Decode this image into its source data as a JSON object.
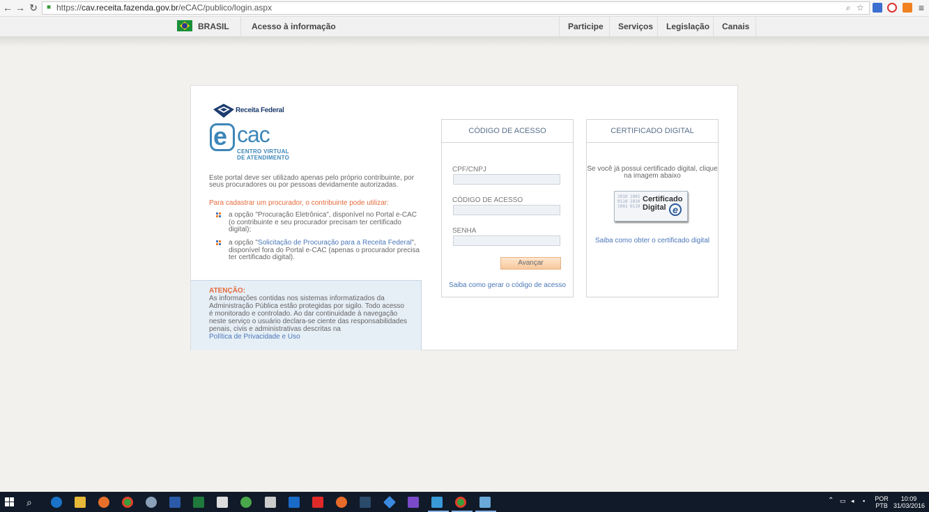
{
  "browser": {
    "url_scheme": "https://",
    "url_host": "cav.receita.fazenda.gov.br",
    "url_path": "/eCAC/publico/login.aspx"
  },
  "govbar": {
    "country": "BRASIL",
    "access": "Acesso à informação",
    "links": [
      "Participe",
      "Serviços",
      "Legislação",
      "Canais"
    ]
  },
  "brand": {
    "agency": "Receita Federal",
    "logo_name": "cac",
    "logo_sub_1": "CENTRO VIRTUAL",
    "logo_sub_2": "DE ATENDIMENTO"
  },
  "info": {
    "intro": "Este portal deve ser utilizado apenas pelo próprio contribuinte, por seus procuradores ou por pessoas devidamente autorizadas.",
    "cad_title": "Para cadastrar um procurador, o contribuinte pode utilizar:",
    "bullet1": "a opção \"Procuração Eletrônica\", disponível no Portal e-CAC (o contribuinte e seu procurador precisam ter certificado digital);",
    "bullet2_pre": "a opção \"",
    "bullet2_link": "Solicitação de Procuração para a Receita Federal",
    "bullet2_post": "\", disponível fora do Portal e-CAC (apenas o procurador precisa ter certificado digital)."
  },
  "attention": {
    "title": "ATENÇÃO:",
    "body": "As informações contidas nos sistemas informatizados da Administração Pública estão protegidas por sigilo. Todo acesso é monitorado e controlado. Ao dar continuidade à navegação neste serviço o usuário declara-se ciente das responsabilidades penais, civis e administrativas descritas na",
    "link": "Política de Privacidade e Uso"
  },
  "access_code": {
    "title": "CÓDIGO DE ACESSO",
    "cpf_label": "CPF/CNPJ",
    "cpf_value": "",
    "code_label": "CÓDIGO DE ACESSO",
    "code_value": "",
    "password_label": "SENHA",
    "password_value": "",
    "submit": "Avançar",
    "help_link": "Saiba como gerar o código de acesso"
  },
  "certificate": {
    "title": "CERTIFICADO DIGITAL",
    "text": "Se você já possui certificado digital, clique na imagem abaixo",
    "img_line1": "Certificado",
    "img_line2": "Digital",
    "img_mark": "e",
    "img_bits": "1010 1001 0110 1010 1001 0110",
    "help_link": "Saiba como obter o certificado digital"
  },
  "taskbar": {
    "lang_1": "POR",
    "lang_2": "PTB",
    "time": "10:09",
    "date": "31/03/2016"
  },
  "colors": {
    "accent_orange": "#e46a3a",
    "link_blue": "#4a77b8",
    "logo_blue": "#3c86b8"
  }
}
